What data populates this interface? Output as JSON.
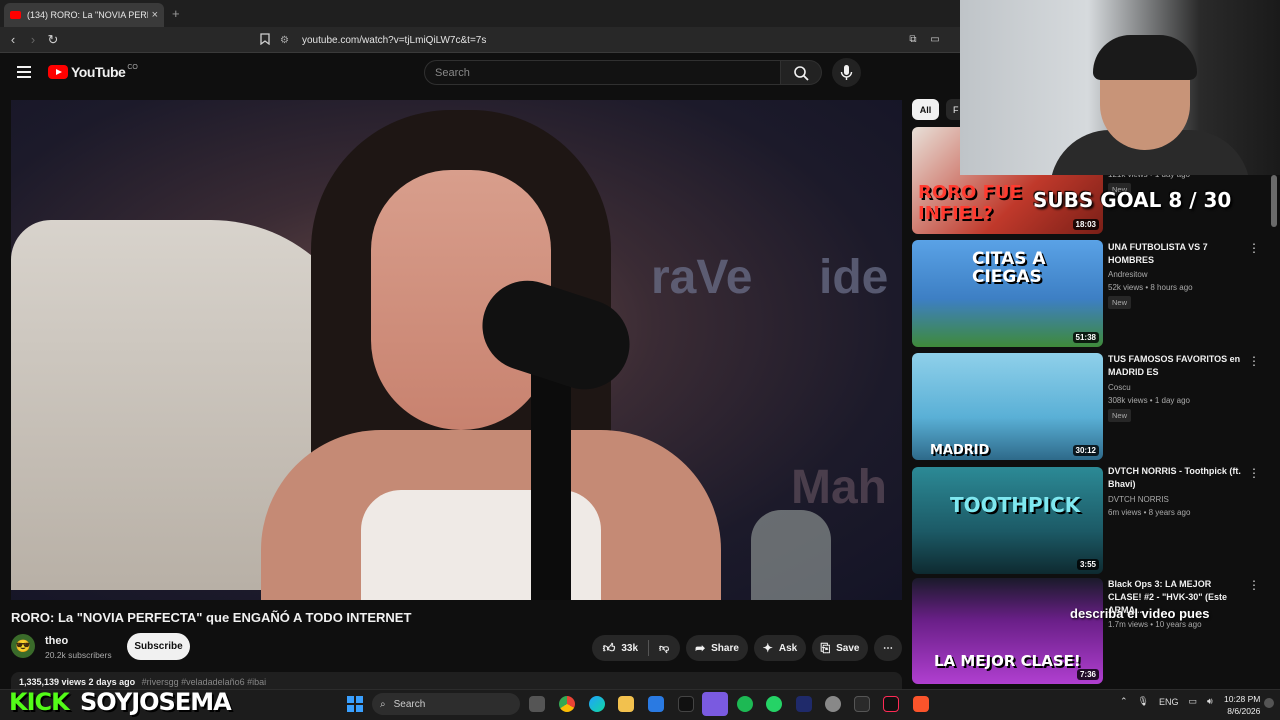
{
  "browser": {
    "tab_title": "(134) RORO: La \"NOVIA PERFECTA\"",
    "tab_close": "×",
    "new_tab": "+",
    "url": "youtube.com/watch?v=tjLmiQiLW7c&t=7s"
  },
  "header": {
    "logo_text": "YouTube",
    "country": "CO",
    "search_placeholder": "Search"
  },
  "video": {
    "title": "RORO: La \"NOVIA PERFECTA\" que ENGAÑÓ A TODO INTERNET",
    "channel": "theo",
    "subscribers": "20.2k subscribers",
    "subscribe_label": "Subscribe",
    "likes": "33k",
    "share_label": "Share",
    "ask_label": "Ask",
    "save_label": "Save",
    "views_date": "1,335,139 views  2 days ago",
    "hashtags": "#riversgg #veladadelaño6 #ibai",
    "bg_brand_1": "raVe",
    "bg_brand_2": "ide",
    "bg_brand_3": "Mah"
  },
  "chips": {
    "all": "All",
    "next": "F"
  },
  "sidebar": {
    "items": [
      {
        "thumb_text": "RORO FUE INFIEL?",
        "duration": "18:03",
        "title": "",
        "channel": "",
        "meta": "121k views • 1 day ago",
        "new": "New",
        "color": "#c0392b"
      },
      {
        "thumb_text": "CITAS A CIEGAS",
        "duration": "51:38",
        "title": "UNA FUTBOLISTA VS 7 HOMBRES",
        "channel": "Andresitow",
        "meta": "52k views • 8 hours ago",
        "new": "New",
        "color": "#4a8fd0"
      },
      {
        "thumb_text": "MADRID",
        "duration": "30:12",
        "title": "TUS FAMOSOS FAVORITOS en MADRID ES",
        "channel": "Coscu",
        "meta": "308k views • 1 day ago",
        "new": "New",
        "color": "#6fb8d8"
      },
      {
        "thumb_text": "TOOTHPICK",
        "duration": "3:55",
        "title": "DVTCH NORRIS - Toothpick (ft. Bhavi)",
        "channel": "DVTCH NORRIS",
        "meta": "6m views • 8 years ago",
        "new": "",
        "color": "#1f6f7a"
      },
      {
        "thumb_text": "LA MEJOR CLASE!",
        "duration": "7:36",
        "title": "Black Ops 3: LA MEJOR CLASE! #2 - \"HVK-30\" (Este ARMA ...",
        "channel": "",
        "meta": "1.7m views • 10 years ago",
        "new": "",
        "color": "#8e2fa8"
      }
    ]
  },
  "stream": {
    "subs_goal": "SUBS GOAL 8 / 30",
    "overlay_message": "describa el video pues",
    "kick": "KICK",
    "username": "SOYJOSEMA"
  },
  "taskbar": {
    "search_label": "Search",
    "language": "ENG",
    "time": "10:28 PM",
    "date": "8/6/2026"
  },
  "colors": {
    "youtube_red": "#ff0000",
    "kick_green": "#53fc18"
  }
}
